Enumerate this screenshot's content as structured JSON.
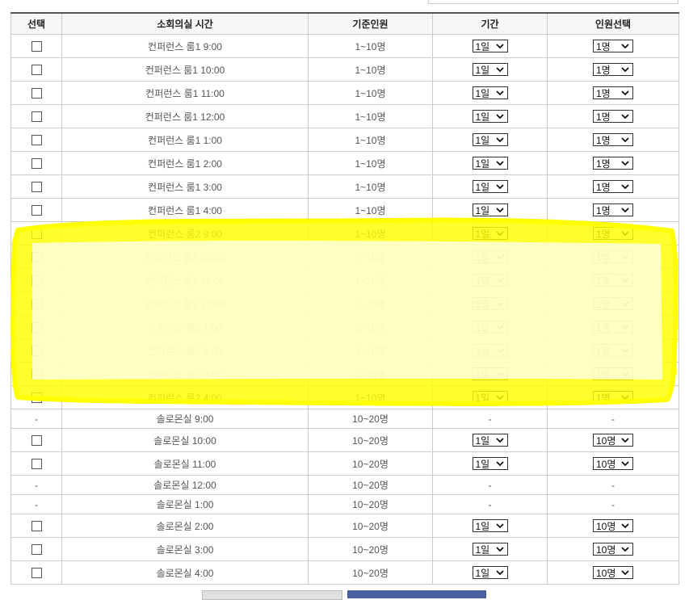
{
  "table": {
    "headers": {
      "select": "선택",
      "time": "소회의실 시간",
      "capacity": "기준인원",
      "duration": "기간",
      "people": "인원선택"
    },
    "rows": [
      {
        "available": true,
        "name": "컨퍼런스 룸1 9:00",
        "capacity": "1~10명",
        "duration": "1일",
        "people": "1명"
      },
      {
        "available": true,
        "name": "컨퍼런스 룸1 10:00",
        "capacity": "1~10명",
        "duration": "1일",
        "people": "1명"
      },
      {
        "available": true,
        "name": "컨퍼런스 룸1 11:00",
        "capacity": "1~10명",
        "duration": "1일",
        "people": "1명"
      },
      {
        "available": true,
        "name": "컨퍼런스 룸1 12:00",
        "capacity": "1~10명",
        "duration": "1일",
        "people": "1명"
      },
      {
        "available": true,
        "name": "컨퍼런스 룸1 1:00",
        "capacity": "1~10명",
        "duration": "1일",
        "people": "1명"
      },
      {
        "available": true,
        "name": "컨퍼런스 룸1 2:00",
        "capacity": "1~10명",
        "duration": "1일",
        "people": "1명"
      },
      {
        "available": true,
        "name": "컨퍼런스 룸1 3:00",
        "capacity": "1~10명",
        "duration": "1일",
        "people": "1명"
      },
      {
        "available": true,
        "name": "컨퍼런스 룸1 4:00",
        "capacity": "1~10명",
        "duration": "1일",
        "people": "1명"
      },
      {
        "available": true,
        "name": "컨퍼런스 룸2 9:00",
        "capacity": "1~10명",
        "duration": "1일",
        "people": "1명"
      },
      {
        "available": true,
        "name": "컨퍼런스 룸2 10:00",
        "capacity": "1~10명",
        "duration": "1일",
        "people": "1명"
      },
      {
        "available": true,
        "name": "컨퍼런스 룸2 11:00",
        "capacity": "1~10명",
        "duration": "1일",
        "people": "1명"
      },
      {
        "available": true,
        "name": "컨퍼런스 룸2 12:00",
        "capacity": "1~10명",
        "duration": "1일",
        "people": "1명"
      },
      {
        "available": true,
        "name": "컨퍼런스 룸2 1:00",
        "capacity": "1~10명",
        "duration": "1일",
        "people": "1명"
      },
      {
        "available": true,
        "name": "컨퍼런스 룸2 2:00",
        "capacity": "1~10명",
        "duration": "1일",
        "people": "1명"
      },
      {
        "available": true,
        "name": "컨퍼런스 룸2 3:00",
        "capacity": "1~10명",
        "duration": "1일",
        "people": "1명"
      },
      {
        "available": true,
        "name": "컨퍼런스 룸2 4:00",
        "capacity": "1~10명",
        "duration": "1일",
        "people": "1명"
      },
      {
        "available": false,
        "name": "솔로몬실 9:00",
        "capacity": "10~20명",
        "dash": "-"
      },
      {
        "available": true,
        "name": "솔로몬실 10:00",
        "capacity": "10~20명",
        "duration": "1일",
        "people": "10명"
      },
      {
        "available": true,
        "name": "솔로몬실 11:00",
        "capacity": "10~20명",
        "duration": "1일",
        "people": "10명"
      },
      {
        "available": false,
        "name": "솔로몬실 12:00",
        "capacity": "10~20명",
        "dash": "-"
      },
      {
        "available": false,
        "name": "솔로몬실 1:00",
        "capacity": "10~20명",
        "dash": "-"
      },
      {
        "available": true,
        "name": "솔로몬실 2:00",
        "capacity": "10~20명",
        "duration": "1일",
        "people": "10명"
      },
      {
        "available": true,
        "name": "솔로몬실 3:00",
        "capacity": "10~20명",
        "duration": "1일",
        "people": "10명"
      },
      {
        "available": true,
        "name": "솔로몬실 4:00",
        "capacity": "10~20명",
        "duration": "1일",
        "people": "10명"
      }
    ]
  },
  "highlight": {
    "color": "#ffff00",
    "rows": "컨퍼런스 룸2 9:00 – 4:00"
  },
  "colors": {
    "border": "#cccccc",
    "header_bg": "#f6f6f6",
    "button_primary": "#4a5fa0",
    "button_secondary": "#e0e0e0"
  }
}
